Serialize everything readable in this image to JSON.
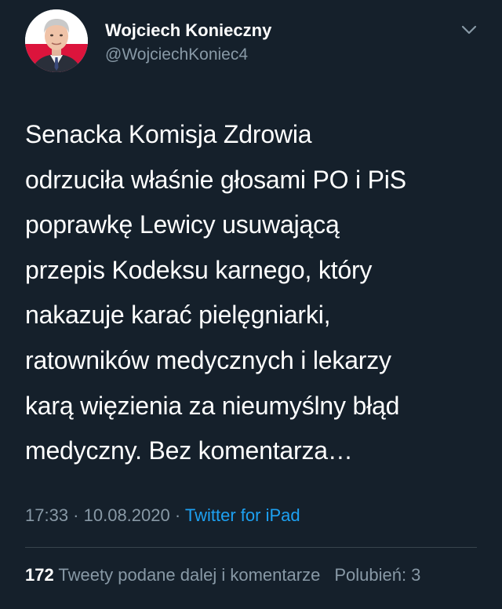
{
  "author": {
    "display_name": "Wojciech Konieczny",
    "handle": "@WojciechKoniec4",
    "avatar_icon": "profile-photo-with-polish-flag"
  },
  "menu": {
    "icon": "chevron-down-icon"
  },
  "tweet": {
    "text": "Senacka Komisja Zdrowia\nodrzuciła właśnie głosami PO i PiS\npoprawkę Lewicy usuwającą\nprzepis Kodeksu karnego, który\nnakazuje karać pielęgniarki,\nratowników medycznych i lekarzy\nkarą więzienia za nieumyślny błąd\nmedyczny. Bez komentarza…"
  },
  "meta": {
    "time": "17:33",
    "separator": " · ",
    "date": "10.08.2020",
    "separator2": " · ",
    "source": "Twitter for iPad"
  },
  "stats": {
    "retweets_count": "172",
    "retweets_label": " Tweety podane dalej i komentarze",
    "likes_label": "Polubień: 3"
  },
  "colors": {
    "background": "#15202b",
    "accent": "#1da1f2",
    "secondary_text": "#8899a6",
    "divider": "#38444d"
  }
}
